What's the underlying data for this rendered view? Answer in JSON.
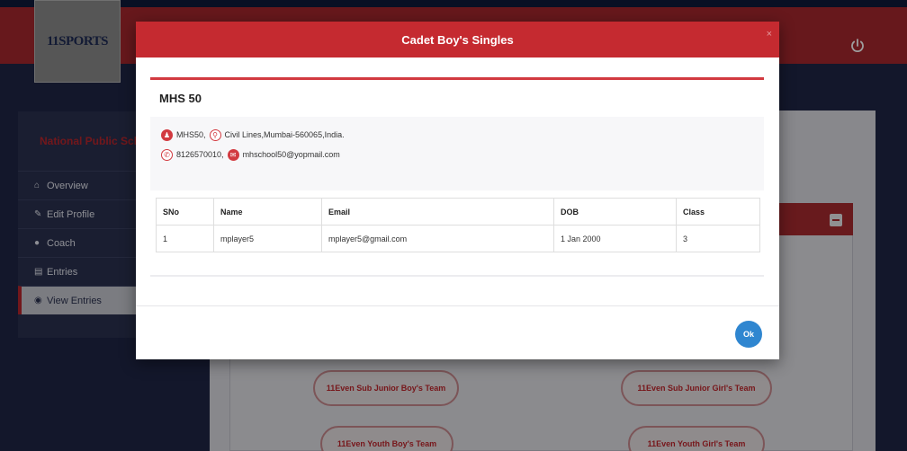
{
  "navbar": {
    "logo_text": "11SPORTS",
    "power_icon": "power-icon",
    "brand_color": "#a7282e"
  },
  "sidebar": {
    "school_name": "National Public School",
    "items": [
      {
        "label": "Overview",
        "icon": "home-icon"
      },
      {
        "label": "Edit Profile",
        "icon": "edit-icon"
      },
      {
        "label": "Coach",
        "icon": "user-icon"
      },
      {
        "label": "Entries",
        "icon": "book-icon"
      },
      {
        "label": "View Entries",
        "icon": "eye-icon"
      }
    ]
  },
  "teams": {
    "sub_junior_boys": "11Even Sub Junior Boy's Team",
    "sub_junior_girls": "11Even Sub Junior Girl's Team",
    "youth_boys": "11Even Youth Boy's Team",
    "youth_girls": "11Even Youth Girl's Team"
  },
  "modal": {
    "title": "Cadet Boy's Singles",
    "close_label": "×",
    "school_code": "MHS 50",
    "address": "MHS50,",
    "address_detail": "Civil Lines,Mumbai-560065,India.",
    "phone": "8126570010,",
    "email": "mhschool50@yopmail.com",
    "table": {
      "headers": [
        "SNo",
        "Name",
        "Email",
        "DOB",
        "Class"
      ],
      "rows": [
        [
          "1",
          "mplayer5",
          "mplayer5@gmail.com",
          "1 Jan 2000",
          "3"
        ]
      ]
    },
    "ok_label": "Ok",
    "accent_color": "#c52a30"
  }
}
